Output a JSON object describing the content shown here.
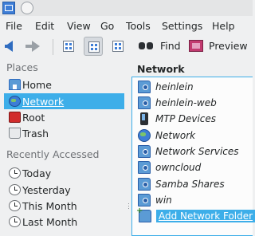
{
  "menu": [
    "File",
    "Edit",
    "View",
    "Go",
    "Tools",
    "Settings",
    "Help"
  ],
  "toolbar": {
    "find_label": "Find",
    "preview_label": "Preview"
  },
  "sidebar": {
    "places_heading": "Places",
    "places": [
      {
        "label": "Home",
        "icon": "home-icon"
      },
      {
        "label": "Network",
        "icon": "network-globe-icon",
        "selected": true
      },
      {
        "label": "Root",
        "icon": "root-icon"
      },
      {
        "label": "Trash",
        "icon": "trash-icon"
      }
    ],
    "recent_heading": "Recently Accessed",
    "recent": [
      {
        "label": "Today",
        "icon": "clock-icon"
      },
      {
        "label": "Yesterday",
        "icon": "clock-icon"
      },
      {
        "label": "This Month",
        "icon": "clock-icon"
      },
      {
        "label": "Last Month",
        "icon": "clock-icon"
      }
    ]
  },
  "content": {
    "title": "Network",
    "items": [
      {
        "name": "heinlein",
        "icon": "network-folder-icon"
      },
      {
        "name": "heinlein-web",
        "icon": "network-folder-icon"
      },
      {
        "name": "MTP Devices",
        "icon": "mobile-device-icon"
      },
      {
        "name": "Network",
        "icon": "network-globe-icon"
      },
      {
        "name": "Network Services",
        "icon": "network-folder-icon"
      },
      {
        "name": "owncloud",
        "icon": "network-folder-icon"
      },
      {
        "name": "Samba Shares",
        "icon": "network-folder-icon"
      },
      {
        "name": "win",
        "icon": "network-folder-icon"
      }
    ],
    "add_item": "Add Network Folder"
  },
  "colors": {
    "selection": "#3daee9",
    "window_bg": "#eff0f1",
    "list_bg": "#fcfcfc"
  }
}
